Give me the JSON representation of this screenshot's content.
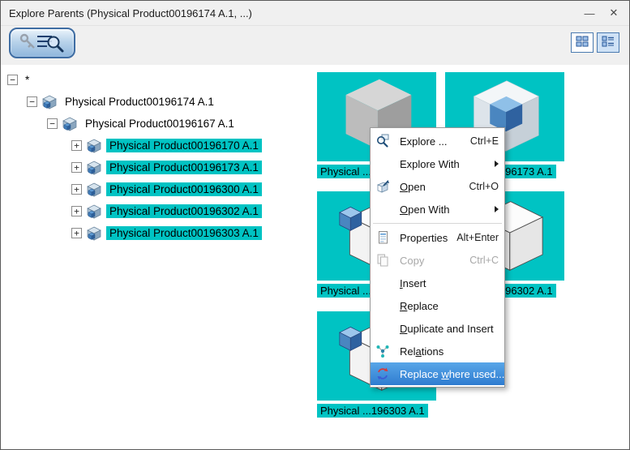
{
  "colors": {
    "selection_teal": "#00c3c3",
    "menu_highlight_blue": "#2f7cd0",
    "toolbar_button_border_blue": "#3f6da3"
  },
  "window": {
    "title": "Explore Parents (Physical Product00196174 A.1, ...)",
    "minimize_glyph": "—",
    "close_glyph": "✕"
  },
  "toolbar": {
    "search_button_icon": "key-search-icon",
    "view_buttons": [
      {
        "icon": "thumbnail-view-icon",
        "active": false
      },
      {
        "icon": "detail-view-icon",
        "active": true
      }
    ]
  },
  "tree": {
    "root_label": "*",
    "nodes": [
      {
        "label": "Physical Product00196174 A.1",
        "level": 1,
        "expander": "minus",
        "selected": false
      },
      {
        "label": "Physical Product00196167 A.1",
        "level": 2,
        "expander": "minus",
        "selected": false
      },
      {
        "label": "Physical Product00196170 A.1",
        "level": 3,
        "expander": "plus",
        "selected": true
      },
      {
        "label": "Physical Product00196173 A.1",
        "level": 3,
        "expander": "plus",
        "selected": true
      },
      {
        "label": "Physical Product00196300 A.1",
        "level": 3,
        "expander": "plus",
        "selected": true
      },
      {
        "label": "Physical Product00196302 A.1",
        "level": 3,
        "expander": "plus",
        "selected": true
      },
      {
        "label": "Physical Product00196303 A.1",
        "level": 3,
        "expander": "plus",
        "selected": true
      }
    ]
  },
  "thumbnails": [
    {
      "label": "Physical ...196170 A.1",
      "variant": "gray"
    },
    {
      "label": "Physical ...196173 A.1",
      "variant": "blue-corner"
    },
    {
      "label": "Physical ...196300 A.1",
      "variant": "outline"
    },
    {
      "label": "Physical ...196302 A.1",
      "variant": "outline"
    },
    {
      "label": "Physical ...196303 A.1",
      "variant": "outline"
    }
  ],
  "context_menu": {
    "items": [
      {
        "label": "Explore ...",
        "shortcut": "Ctrl+E",
        "icon": "explore-icon"
      },
      {
        "label": "Explore With",
        "submenu": true
      },
      {
        "label": "Open",
        "shortcut": "Ctrl+O",
        "icon": "open-icon",
        "underline": 0
      },
      {
        "label": "Open With",
        "submenu": true,
        "underline": 0
      },
      {
        "type": "separator"
      },
      {
        "label": "Properties",
        "shortcut": "Alt+Enter",
        "icon": "properties-icon"
      },
      {
        "label": "Copy",
        "shortcut": "Ctrl+C",
        "icon": "copy-icon",
        "disabled": true
      },
      {
        "label": "Insert",
        "underline": 0
      },
      {
        "label": "Replace",
        "underline": 0
      },
      {
        "label": "Duplicate and Insert",
        "underline": 0
      },
      {
        "label": "Relations",
        "icon": "relations-icon",
        "underline": 3
      },
      {
        "label": "Replace where used...",
        "icon": "replace-where-used-icon",
        "selected": true,
        "underline": 8
      }
    ]
  }
}
